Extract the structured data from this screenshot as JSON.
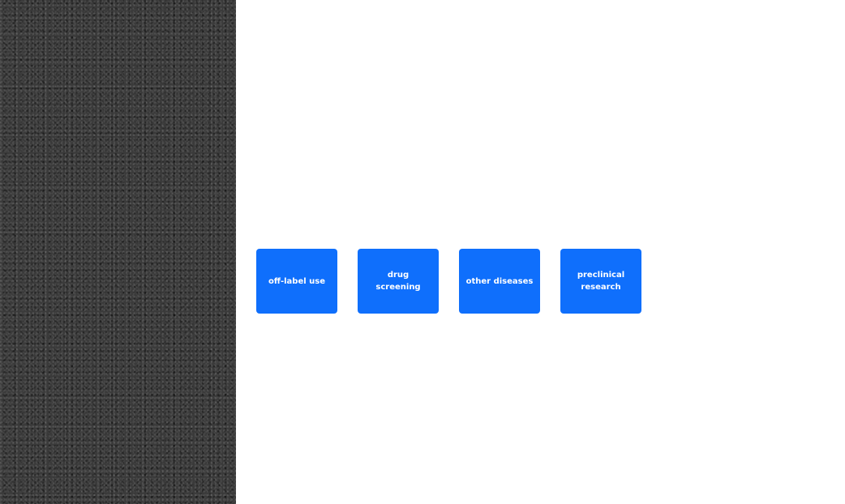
{
  "colors": {
    "left_panel_texture": "#3a3a3a",
    "button_background": "#0f6ffc",
    "button_text": "#ffffff",
    "content_background": "#ffffff"
  },
  "options": [
    {
      "label": "off-label use"
    },
    {
      "label": "drug screening"
    },
    {
      "label": "other diseases"
    },
    {
      "label": "preclinical research"
    }
  ]
}
